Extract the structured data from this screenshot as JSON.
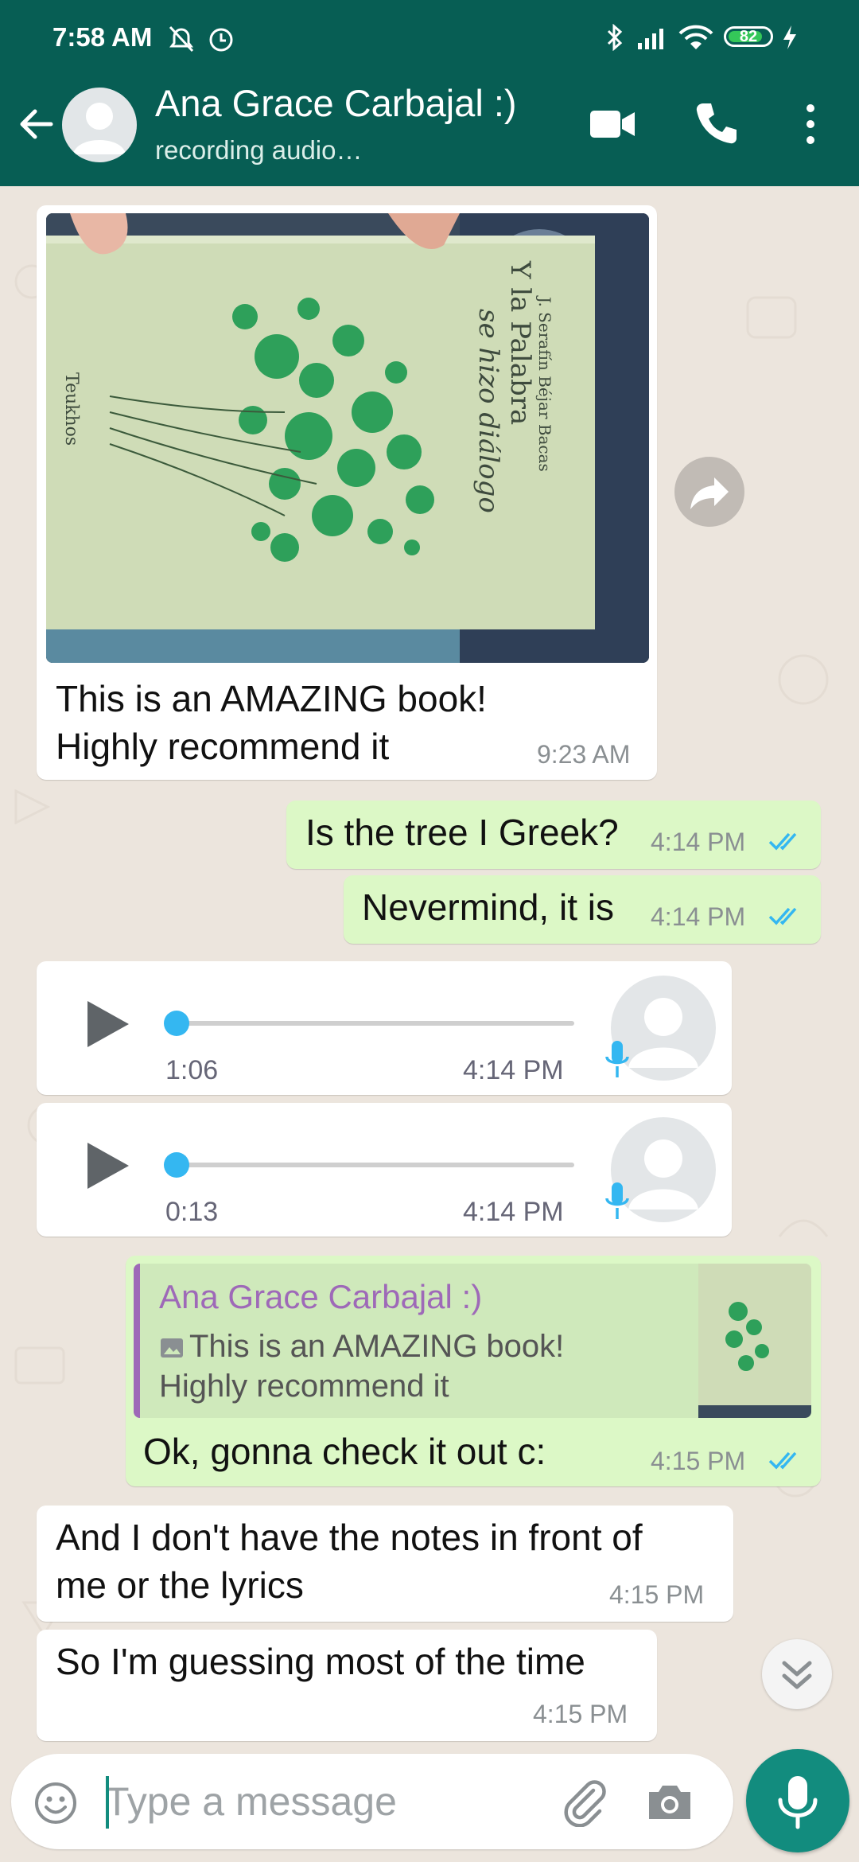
{
  "status_bar": {
    "time": "7:58 AM",
    "battery": "82"
  },
  "header": {
    "contact_name": "Ana Grace Carbajal :)",
    "contact_status": "recording audio…"
  },
  "messages": [
    {
      "direction": "in",
      "type": "image",
      "text_line1": "This is an AMAZING book!",
      "text_line2": "Highly recommend it",
      "time": "9:23 AM"
    },
    {
      "direction": "out",
      "type": "text",
      "text": "Is the tree I Greek?",
      "time": "4:14 PM",
      "status": "read"
    },
    {
      "direction": "out",
      "type": "text",
      "text": "Nevermind, it is",
      "time": "4:14 PM",
      "status": "read"
    },
    {
      "direction": "in",
      "type": "voice",
      "duration": "1:06",
      "time": "4:14 PM",
      "progress": 0.0
    },
    {
      "direction": "in",
      "type": "voice",
      "duration": "0:13",
      "time": "4:14 PM",
      "progress": 0.0
    },
    {
      "direction": "out",
      "type": "reply",
      "quote_author": "Ana Grace Carbajal :)",
      "quote_line1": "This is an AMAZING book!",
      "quote_line2": "Highly recommend it",
      "text": "Ok, gonna check it out c:",
      "time": "4:15 PM",
      "status": "read"
    },
    {
      "direction": "in",
      "type": "text",
      "text_line1": "And I don't have the notes in front of",
      "text_line2": "me or the lyrics",
      "time": "4:15 PM"
    },
    {
      "direction": "in",
      "type": "text",
      "text": "So I'm guessing most of the time",
      "time": "4:15 PM"
    }
  ],
  "photo_book": {
    "author": "J. Serafín Béjar Bacas",
    "title_line1": "Y la Palabra",
    "title_line2": "se hizo diálogo",
    "publisher": "Teukhos"
  },
  "composer": {
    "placeholder": "Type a message"
  },
  "colors": {
    "header": "#075e54",
    "outgoing_bubble": "#dcf8c6",
    "incoming_bubble": "#ffffff",
    "chat_background": "#ece5dd",
    "read_ticks": "#34b7f1",
    "accent": "#128c7e",
    "quote_author": "#9e69b8"
  },
  "icons": [
    "back-arrow",
    "default-avatar",
    "video-camera",
    "phone",
    "more-vertical",
    "forward",
    "play",
    "microphone",
    "chevron-double-down",
    "emoji",
    "paperclip",
    "camera",
    "mute-bell",
    "alarm",
    "bluetooth",
    "signal",
    "wifi",
    "charging-bolt"
  ]
}
